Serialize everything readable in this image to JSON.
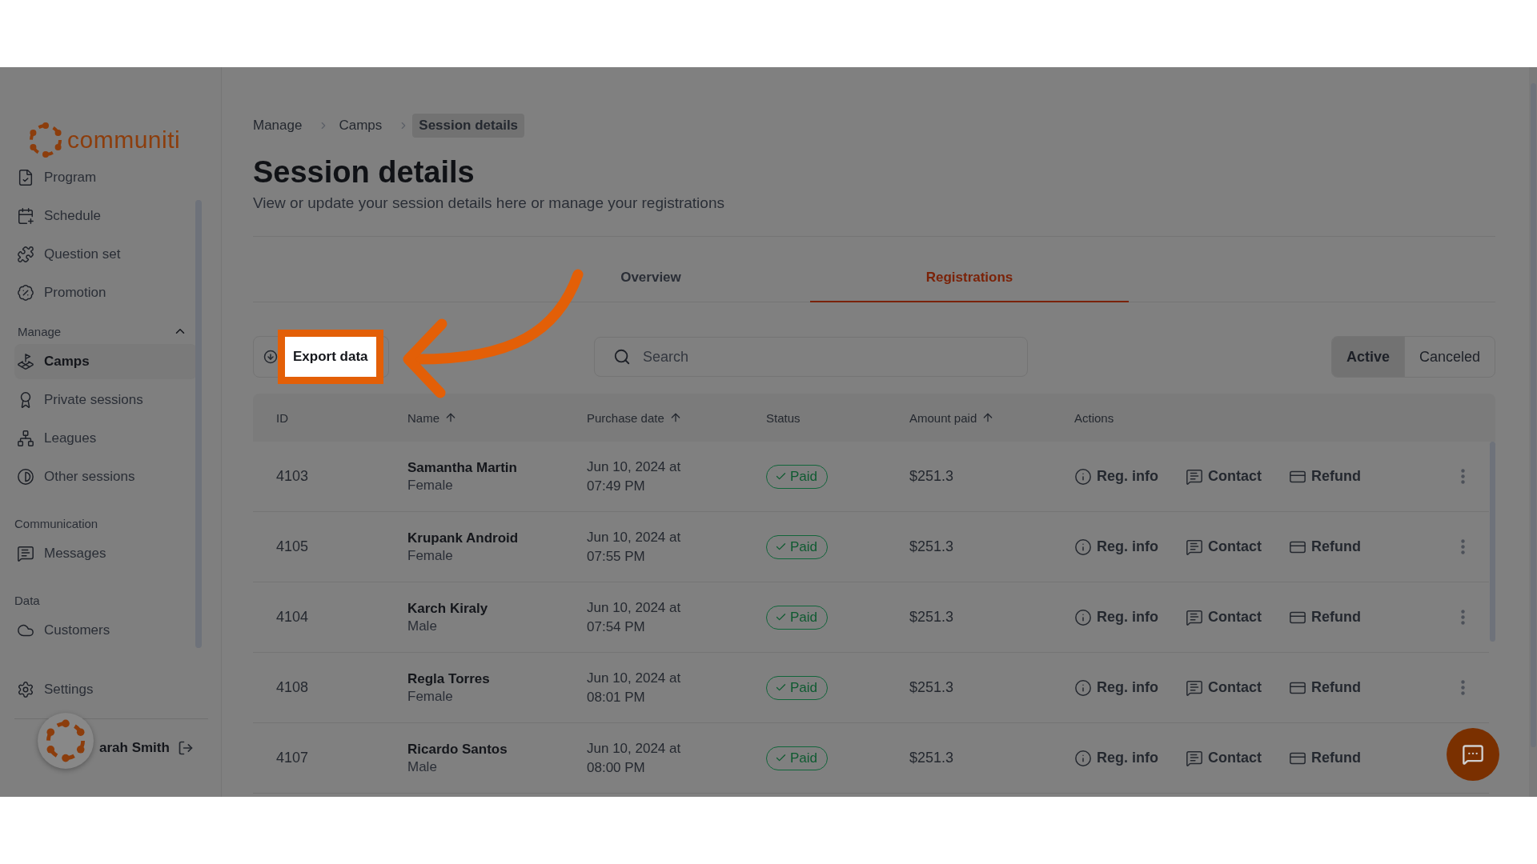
{
  "sidebar": {
    "logo": "communiti",
    "groups": [
      {
        "items": [
          {
            "label": "Program",
            "selected": false
          },
          {
            "label": "Schedule",
            "selected": false
          },
          {
            "label": "Question set",
            "selected": false
          },
          {
            "label": "Promotion",
            "selected": false
          }
        ]
      },
      {
        "label": "Manage",
        "expanded": true,
        "items": [
          {
            "label": "Camps",
            "selected": true
          },
          {
            "label": "Private sessions",
            "selected": false
          },
          {
            "label": "Leagues",
            "selected": false
          },
          {
            "label": "Other sessions",
            "selected": false
          }
        ]
      },
      {
        "label": "Communication",
        "items": [
          {
            "label": "Messages",
            "selected": false
          }
        ]
      },
      {
        "label": "Data",
        "items": [
          {
            "label": "Customers",
            "selected": false
          }
        ]
      }
    ],
    "settings": {
      "label": "Settings",
      "selected": false
    },
    "user": {
      "name": "arah Smith"
    }
  },
  "breadcrumb": [
    {
      "label": "Manage",
      "current": false
    },
    {
      "label": "Camps",
      "current": false
    },
    {
      "label": "Session details",
      "current": true
    }
  ],
  "title": "Session details",
  "subtitle": "View or update your session details here or manage your registrations",
  "tabs": [
    {
      "label": "Overview",
      "selected": false
    },
    {
      "label": "Registrations",
      "selected": true
    }
  ],
  "export_button": "Export data",
  "search": {
    "placeholder": "Search"
  },
  "filters": [
    {
      "label": "Active",
      "selected": true
    },
    {
      "label": "Canceled",
      "selected": false
    }
  ],
  "table": {
    "columns": [
      {
        "label": "ID",
        "sortable": false
      },
      {
        "label": "Name",
        "sortable": true
      },
      {
        "label": "Purchase date",
        "sortable": true
      },
      {
        "label": "Status",
        "sortable": false
      },
      {
        "label": "Amount paid",
        "sortable": true
      },
      {
        "label": "Actions",
        "sortable": false
      }
    ],
    "rows": [
      {
        "id": "4103",
        "name": "Samantha Martin",
        "gender": "Female",
        "purchase_date": "Jun 10, 2024 at 07:49 PM",
        "status": {
          "label": "Paid",
          "kind": "paid"
        },
        "amount": "$251.3",
        "actions": [
          "Reg. info",
          "Contact",
          "Refund"
        ]
      },
      {
        "id": "4105",
        "name": "Krupank Android",
        "gender": "Female",
        "purchase_date": "Jun 10, 2024 at 07:55 PM",
        "status": {
          "label": "Paid",
          "kind": "paid"
        },
        "amount": "$251.3",
        "actions": [
          "Reg. info",
          "Contact",
          "Refund"
        ]
      },
      {
        "id": "4104",
        "name": "Karch Kiraly",
        "gender": "Male",
        "purchase_date": "Jun 10, 2024 at 07:54 PM",
        "status": {
          "label": "Paid",
          "kind": "paid"
        },
        "amount": "$251.3",
        "actions": [
          "Reg. info",
          "Contact",
          "Refund"
        ]
      },
      {
        "id": "4108",
        "name": "Regla Torres",
        "gender": "Female",
        "purchase_date": "Jun 10, 2024 at 08:01 PM",
        "status": {
          "label": "Paid",
          "kind": "paid"
        },
        "amount": "$251.3",
        "actions": [
          "Reg. info",
          "Contact",
          "Refund"
        ]
      },
      {
        "id": "4107",
        "name": "Ricardo Santos",
        "gender": "Male",
        "purchase_date": "Jun 10, 2024 at 08:00 PM",
        "status": {
          "label": "Paid",
          "kind": "paid"
        },
        "amount": "$251.3",
        "actions": [
          "Reg. info",
          "Contact",
          "Refund"
        ]
      }
    ]
  }
}
